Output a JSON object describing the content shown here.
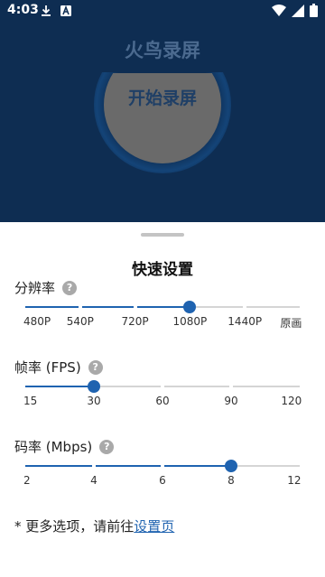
{
  "status_bar": {
    "time": "4:03",
    "icons": [
      "download-icon",
      "a-box-icon",
      "wifi-icon",
      "signal-icon",
      "battery-icon"
    ]
  },
  "header": {
    "app_title": "火鸟录屏",
    "record_button_label": "开始录屏"
  },
  "sheet": {
    "title": "快速设置",
    "resolution": {
      "label": "分辨率",
      "ticks": [
        "480P",
        "540P",
        "720P",
        "1080P",
        "1440P",
        "原画"
      ],
      "selected_index": 3
    },
    "fps": {
      "label": "帧率 (FPS)",
      "ticks": [
        "15",
        "30",
        "60",
        "90",
        "120"
      ],
      "selected_index": 1
    },
    "bitrate": {
      "label": "码率 (Mbps)",
      "ticks": [
        "2",
        "4",
        "6",
        "8",
        "12"
      ],
      "selected_index": 3
    },
    "footnote_prefix": "* 更多选项，请前往",
    "footnote_link": "设置页"
  },
  "colors": {
    "background": "#0e2d52",
    "accent": "#1f63b0",
    "record_button": "#6a6a6a"
  }
}
